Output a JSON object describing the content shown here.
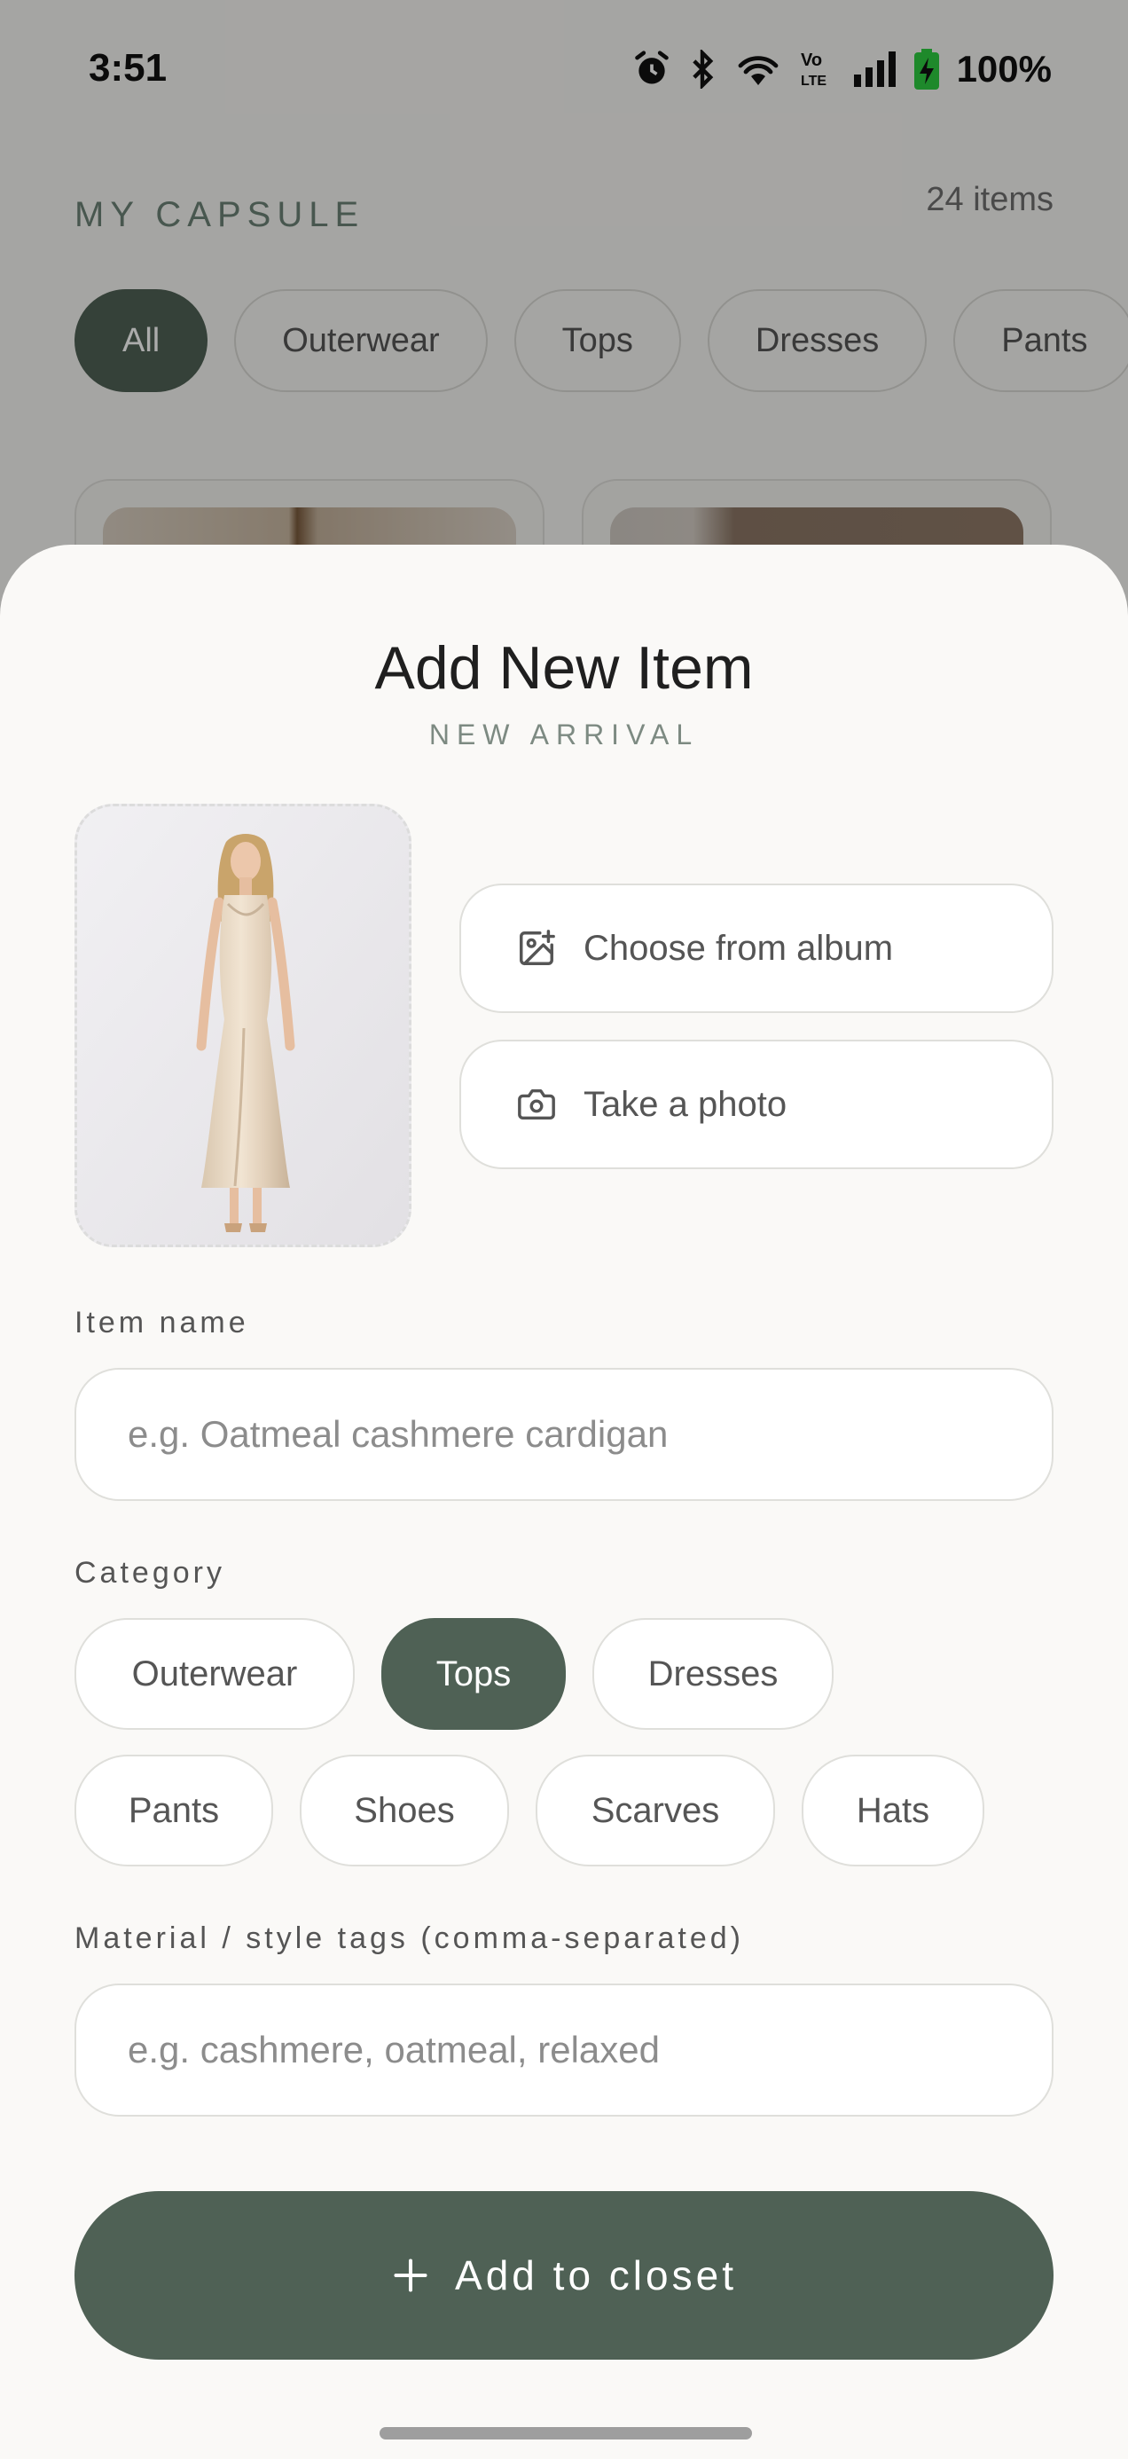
{
  "status_bar": {
    "time": "3:51",
    "battery": "100%",
    "icons": [
      "alarm-icon",
      "bluetooth-icon",
      "wifi-icon",
      "volte-icon",
      "signal-icon",
      "battery-charging-icon"
    ]
  },
  "capsule": {
    "title": "MY CAPSULE",
    "count": "24 items",
    "filters": [
      "All",
      "Outerwear",
      "Tops",
      "Dresses",
      "Pants"
    ],
    "active_filter": "All"
  },
  "sheet": {
    "title": "Add New Item",
    "subtitle": "NEW ARRIVAL",
    "photo_buttons": {
      "album": "Choose from album",
      "camera": "Take a photo"
    },
    "item_name": {
      "label": "Item name",
      "placeholder": "e.g. Oatmeal cashmere cardigan"
    },
    "category": {
      "label": "Category",
      "row1": [
        "Outerwear",
        "Tops",
        "Dresses"
      ],
      "row2": [
        "Pants",
        "Shoes",
        "Scarves",
        "Hats"
      ],
      "selected": "Tops"
    },
    "tags": {
      "label": "Material / style tags (comma-separated)",
      "placeholder": "e.g. cashmere, oatmeal, relaxed"
    },
    "submit": "Add to closet"
  },
  "colors": {
    "accent": "#4f6155",
    "background": "#faf9f7"
  }
}
